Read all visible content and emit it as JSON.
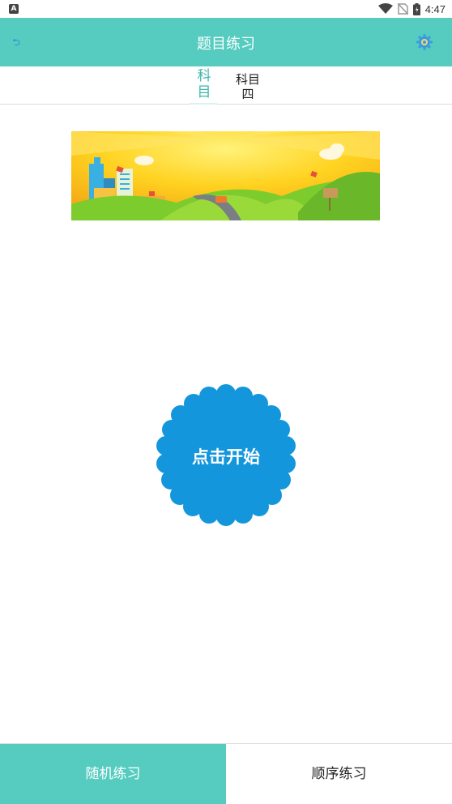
{
  "status_bar": {
    "time": "4:47",
    "left_icon": "a-notification-icon",
    "icons": [
      "wifi-icon",
      "no-sim-icon",
      "battery-icon"
    ]
  },
  "header": {
    "title": "题目练习",
    "back_icon": "back-icon",
    "settings_icon": "settings-icon",
    "background_color": "#56ccc0"
  },
  "tabs": [
    {
      "label": "科目",
      "sub": "目",
      "selected": true
    },
    {
      "label": "科目",
      "sub": "四",
      "selected": false
    }
  ],
  "banner": {
    "image": "cartoon city and road landscape illustration"
  },
  "start_button": {
    "label": "点击开始",
    "color": "#1496dc"
  },
  "bottom_bar": {
    "left_label": "随机练习",
    "right_label": "顺序练习",
    "left_color": "#56ccc0"
  }
}
